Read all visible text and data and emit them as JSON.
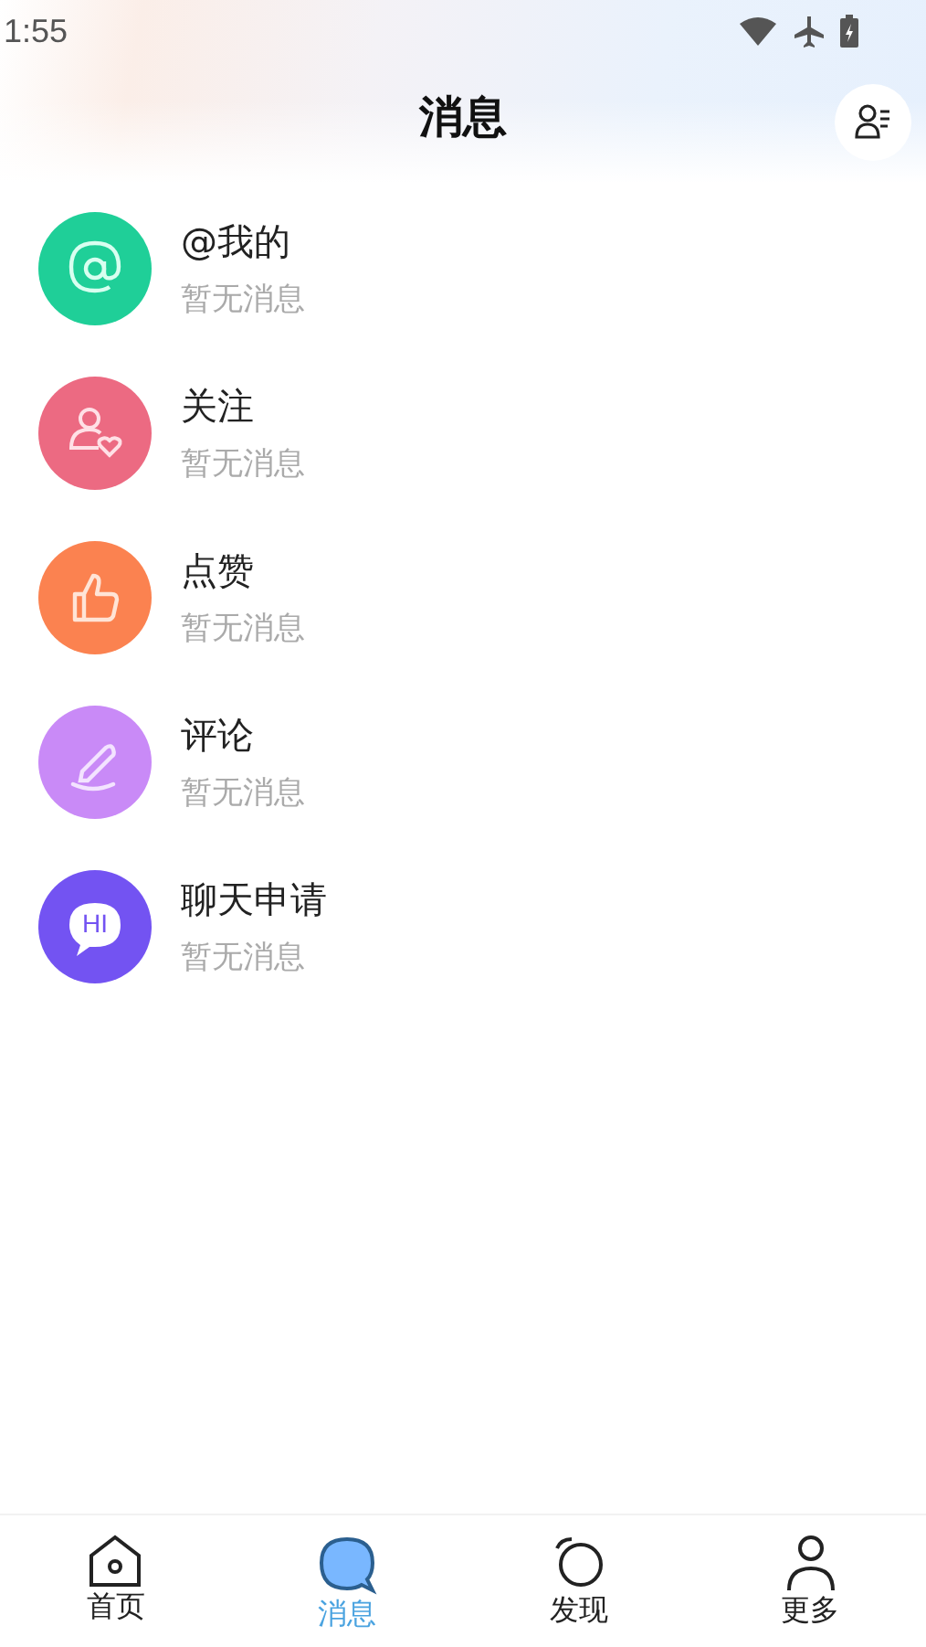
{
  "status_bar": {
    "time": "1:55"
  },
  "header": {
    "title": "消息"
  },
  "messages": [
    {
      "kind": "at",
      "name": "@我的",
      "preview": "暂无消息",
      "color": "#1fcf98"
    },
    {
      "kind": "follow",
      "name": "关注",
      "preview": "暂无消息",
      "color": "#ec6a82"
    },
    {
      "kind": "like",
      "name": "点赞",
      "preview": "暂无消息",
      "color": "#fb8250"
    },
    {
      "kind": "comment",
      "name": "评论",
      "preview": "暂无消息",
      "color": "#c98af7"
    },
    {
      "kind": "chat",
      "name": "聊天申请",
      "preview": "暂无消息",
      "color": "#7353f2",
      "icon_text": "HI"
    }
  ],
  "nav": [
    {
      "kind": "home",
      "label": "首页",
      "selected": false
    },
    {
      "kind": "messages",
      "label": "消息",
      "selected": true
    },
    {
      "kind": "discover",
      "label": "发现",
      "selected": false
    },
    {
      "kind": "more",
      "label": "更多",
      "selected": false
    }
  ]
}
